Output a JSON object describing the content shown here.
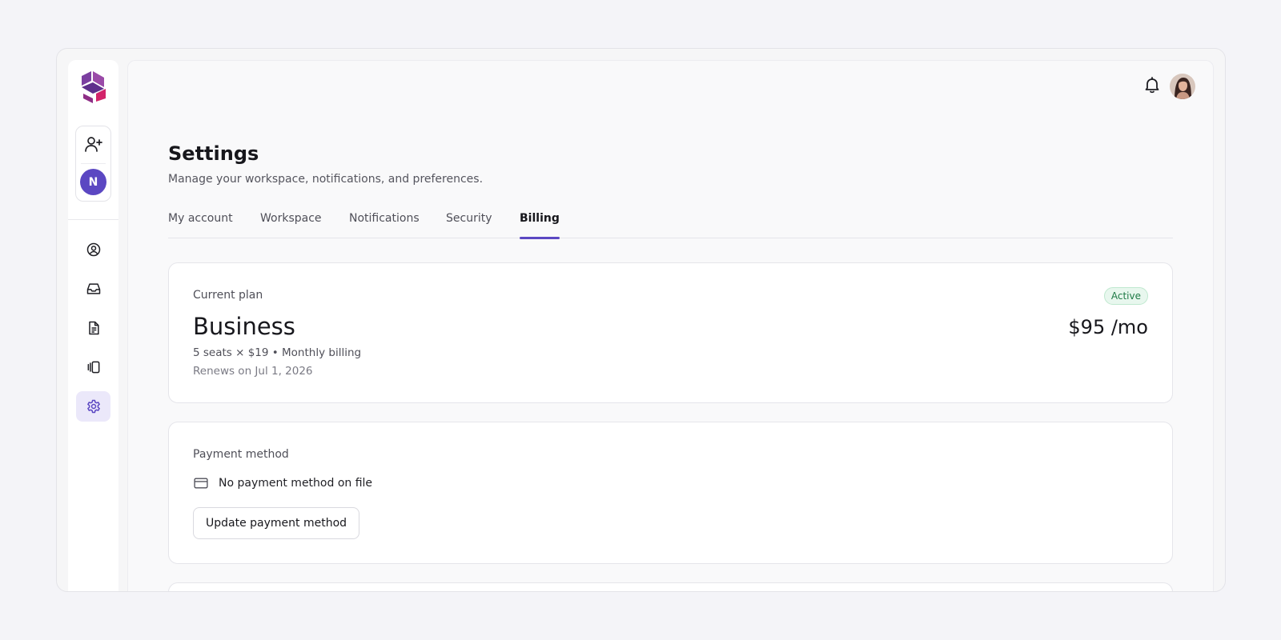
{
  "page": {
    "title": "Settings",
    "subtitle": "Manage your workspace, notifications, and preferences."
  },
  "sidebar": {
    "team_avatar_initial": "N",
    "nav": [
      {
        "name": "profile",
        "icon": "user-circle-icon"
      },
      {
        "name": "inbox",
        "icon": "inbox-icon"
      },
      {
        "name": "documents",
        "icon": "document-icon"
      },
      {
        "name": "boards",
        "icon": "cards-icon"
      },
      {
        "name": "settings",
        "icon": "gear-icon",
        "active": true
      }
    ]
  },
  "header": {
    "icons": [
      "bell-icon",
      "user-avatar"
    ]
  },
  "tabs": [
    {
      "label": "My account"
    },
    {
      "label": "Workspace"
    },
    {
      "label": "Notifications"
    },
    {
      "label": "Security"
    },
    {
      "label": "Billing",
      "active": true
    }
  ],
  "plan": {
    "label": "Current plan",
    "name": "Business",
    "details": "5 seats × $19 • Monthly billing",
    "renews": "Renews on Jul 1, 2026",
    "status": "Active",
    "price": "$95 /mo"
  },
  "payment": {
    "label": "Payment method",
    "status_text": "No payment method on file",
    "button_label": "Update payment method"
  },
  "colors": {
    "accent": "#5b47c2",
    "active_badge_bg": "#e8f7ee",
    "active_badge_text": "#1e7a46"
  }
}
